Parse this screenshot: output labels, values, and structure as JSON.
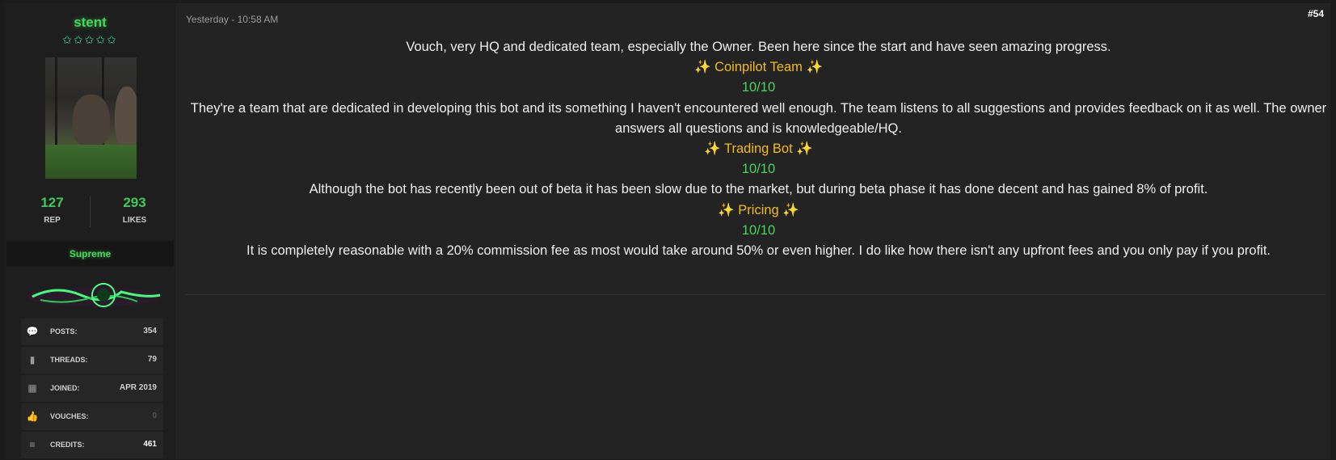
{
  "author": {
    "username": "stent",
    "stars": "✩✩✩✩✩",
    "rep_value": "127",
    "rep_label": "REP",
    "likes_value": "293",
    "likes_label": "LIKES",
    "rank": "Supreme",
    "info": [
      {
        "icon": "comments-icon",
        "label": "POSTS:",
        "value": "354"
      },
      {
        "icon": "book-icon",
        "label": "THREADS:",
        "value": "79"
      },
      {
        "icon": "calendar-icon",
        "label": "JOINED:",
        "value": "APR 2019"
      },
      {
        "icon": "thumbs-up-icon",
        "label": "VOUCHES:",
        "value": "0"
      },
      {
        "icon": "coins-icon",
        "label": "CREDITS:",
        "value": "461"
      }
    ]
  },
  "post": {
    "timestamp": "Yesterday - 10:58 AM",
    "number": "#54",
    "lines": {
      "intro": "Vouch, very HQ and dedicated team, especially the Owner. Been here since the start and have seen amazing progress.",
      "team_heading": "Coinpilot Team",
      "team_rating": "10/10",
      "team_text": "They're a team that are dedicated in developing this bot and its something I haven't encountered well enough. The team listens to all suggestions and provides feedback on it as well. The owner answers all questions and is knowledgeable/HQ.",
      "bot_heading": "Trading Bot",
      "bot_rating": "10/10",
      "bot_text": "Although the bot has recently been out of beta it has been slow due to the market, but during beta phase it has done decent and has gained 8% of profit.",
      "pricing_heading": "Pricing",
      "pricing_rating": "10/10",
      "pricing_text": "It is completely reasonable with a 20% commission fee as most would take around 50% or even higher. I do like how there isn't any upfront fees and you only pay if you profit."
    },
    "sparkle": "✨"
  },
  "colors": {
    "accent_green": "#45d65b",
    "heading_gold": "#f2bc1b",
    "corner_red": "#d92b2b"
  }
}
